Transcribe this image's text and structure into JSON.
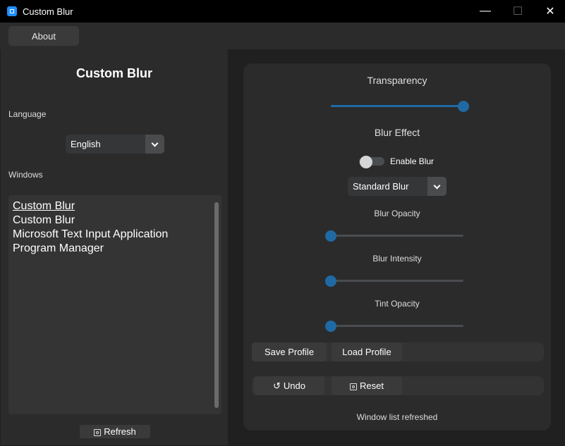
{
  "window": {
    "title": "Custom Blur",
    "controls": {
      "minimize": "—",
      "maximize": "☐",
      "close": "✕"
    }
  },
  "toolbar": {
    "about_label": "About"
  },
  "sidebar": {
    "app_title": "Custom Blur",
    "language_label": "Language",
    "language_value": "English",
    "windows_label": "Windows",
    "windows": [
      "Custom Blur",
      "Custom Blur",
      "Microsoft Text Input Application",
      "Program Manager"
    ],
    "refresh_label": "Refresh"
  },
  "settings": {
    "transparency_title": "Transparency",
    "transparency_level": 1.0,
    "blur_effect_title": "Blur Effect",
    "enable_blur_label": "Enable Blur",
    "enable_blur_on": false,
    "blur_type_value": "Standard Blur",
    "blur_opacity_label": "Blur Opacity",
    "blur_opacity_level": 0.0,
    "blur_intensity_label": "Blur Intensity",
    "blur_intensity_level": 0.0,
    "tint_opacity_label": "Tint Opacity",
    "tint_opacity_level": 0.0,
    "save_profile_label": "Save Profile",
    "load_profile_label": "Load Profile",
    "undo_label": "Undo",
    "reset_label": "Reset",
    "status_text": "Window list refreshed"
  },
  "colors": {
    "accent": "#1f6aa5",
    "panel": "#2b2b2b",
    "titlebar": "#000000"
  }
}
